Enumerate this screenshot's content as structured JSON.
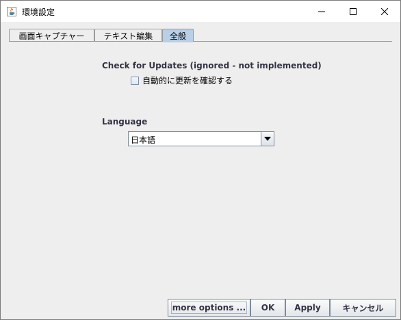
{
  "window": {
    "title": "環境設定",
    "icon": "java-cup-icon"
  },
  "tabs": [
    {
      "label": "画面キャプチャー",
      "selected": false
    },
    {
      "label": "テキスト編集",
      "selected": false
    },
    {
      "label": "全般",
      "selected": true
    }
  ],
  "updates": {
    "section_label": "Check for Updates (ignored - not implemented)",
    "checkbox_label": "自動的に更新を確認する",
    "checked": false
  },
  "language": {
    "section_label": "Language",
    "selected_value": "日本語"
  },
  "buttons": {
    "more_options": "more options ...",
    "ok": "OK",
    "apply": "Apply",
    "cancel": "キャンセル"
  },
  "colors": {
    "selected_tab": "#b8cfe5",
    "background": "#eeeeee",
    "label_text": "#333344"
  }
}
